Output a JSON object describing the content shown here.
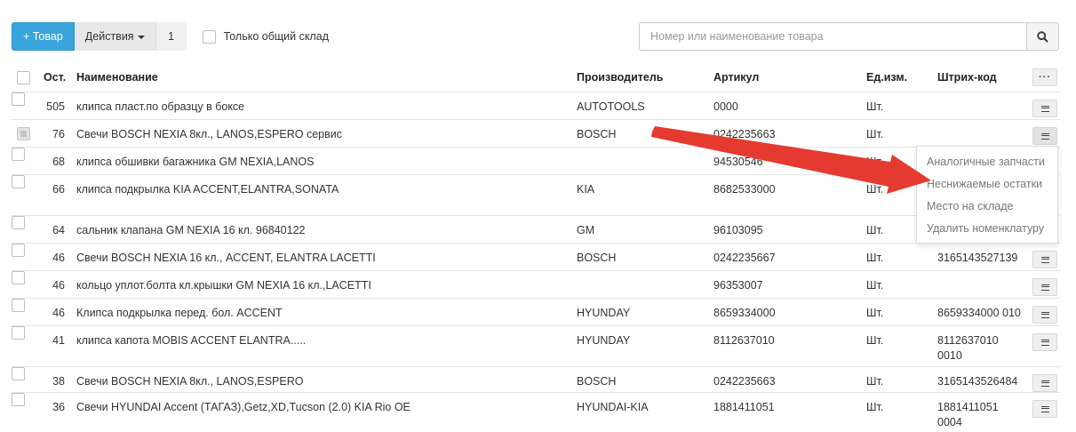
{
  "toolbar": {
    "add_label": "+ Товар",
    "actions_label": "Действия",
    "count": "1",
    "only_common_label": "Только общий склад"
  },
  "search": {
    "placeholder": "Номер или наименование товара",
    "value": ""
  },
  "table": {
    "headers": {
      "ost": "Ост.",
      "name": "Наименование",
      "manufacturer": "Производитель",
      "article": "Артикул",
      "unit": "Ед.изм.",
      "barcode": "Штрих-код",
      "more": "···"
    },
    "rows": [
      {
        "ost": "505",
        "name": "клипса пласт.по образцу в боксе",
        "manufacturer": "AUTOTOOLS",
        "article": "0000",
        "unit": "Шт.",
        "barcode": ""
      },
      {
        "ost": "76",
        "name": "Свечи BOSCH NEXIA 8кл., LANOS,ESPERO сервис",
        "manufacturer": "BOSCH",
        "article": "0242235663",
        "unit": "Шт.",
        "barcode": ""
      },
      {
        "ost": "68",
        "name": "клипса обшивки багажника GM NEXIA,LANOS",
        "manufacturer": "",
        "article": "94530546",
        "unit": "Шт.",
        "barcode": ""
      },
      {
        "ost": "66",
        "name": "клипса подкрылка KIA ACCENT,ELANTRA,SONATA",
        "manufacturer": "KIA",
        "article": "8682533000",
        "unit": "Шт.",
        "barcode": ""
      },
      {
        "ost": "64",
        "name": "сальник клапана GM NEXIA 16 кл. 96840122",
        "manufacturer": "GM",
        "article": "96103095",
        "unit": "Шт.",
        "barcode": ""
      },
      {
        "ost": "46",
        "name": "Свечи BOSCH NEXIA 16 кл., ACCENT, ELANTRA LACETTI",
        "manufacturer": "BOSCH",
        "article": "0242235667",
        "unit": "Шт.",
        "barcode": "3165143527139"
      },
      {
        "ost": "46",
        "name": "кольцо уплот.болта кл.крышки GM NEXIA 16 кл.,LACETTI",
        "manufacturer": "",
        "article": "96353007",
        "unit": "Шт.",
        "barcode": ""
      },
      {
        "ost": "46",
        "name": "Клипса подкрылка перед. бол. ACCENT",
        "manufacturer": "HYUNDAY",
        "article": "8659334000",
        "unit": "Шт.",
        "barcode": "8659334000 010"
      },
      {
        "ost": "41",
        "name": "клипса капота MOBIS ACCENT ELANTRA.....",
        "manufacturer": "HYUNDAY",
        "article": "8112637010",
        "unit": "Шт.",
        "barcode": "8112637010 0010"
      },
      {
        "ost": "38",
        "name": "Свечи BOSCH NEXIA 8кл., LANOS,ESPERO",
        "manufacturer": "BOSCH",
        "article": "0242235663",
        "unit": "Шт.",
        "barcode": "3165143526484"
      },
      {
        "ost": "36",
        "name": "Свечи HYUNDAI Accent (ТАГАЗ),Getz,XD,Tucson (2.0) KIA Rio OE",
        "manufacturer": "HYUNDAI-KIA",
        "article": "1881411051",
        "unit": "Шт.",
        "barcode": "1881411051 0004"
      }
    ]
  },
  "dropdown": {
    "items": [
      "Аналогичные запчасти",
      "Неснижаемые остатки",
      "Место на складе",
      "Удалить номенклатуру"
    ]
  },
  "colors": {
    "primary": "#3aa5dc",
    "arrow": "#e53a2f"
  }
}
